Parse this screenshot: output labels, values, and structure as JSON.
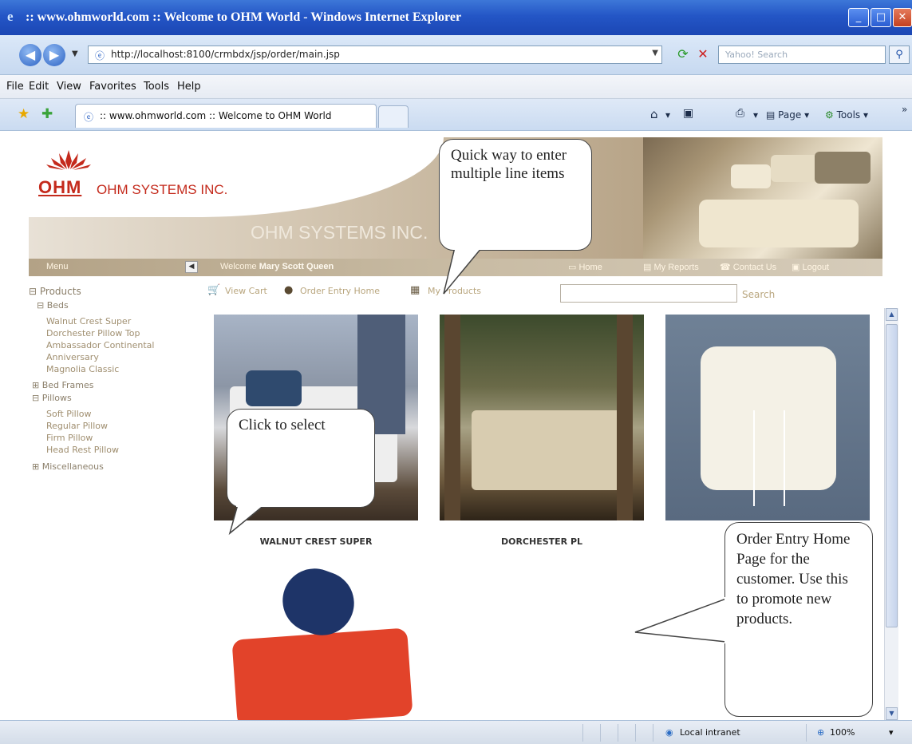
{
  "window": {
    "title": ":: www.ohmworld.com :: Welcome to OHM World - Windows Internet Explorer",
    "url": "http://localhost:8100/crmbdx/jsp/order/main.jsp",
    "search_placeholder": "Yahoo! Search"
  },
  "menubar": [
    "File",
    "Edit",
    "View",
    "Favorites",
    "Tools",
    "Help"
  ],
  "tab": {
    "label": ":: www.ohmworld.com :: Welcome to OHM World"
  },
  "toolbar": {
    "page_label": "Page",
    "tools_label": "Tools"
  },
  "banner": {
    "logo_text": "OHM",
    "company": "OHM SYSTEMS INC.",
    "watermark": "OHM SYSTEMS INC."
  },
  "nav": {
    "menu_label": "Menu",
    "welcome_prefix": "Welcome",
    "user_name": "Mary Scott Queen",
    "home": "Home",
    "my_reports": "My Reports",
    "contact_us": "Contact Us",
    "logout": "Logout"
  },
  "actions": {
    "view_cart": "View Cart",
    "order_entry_home": "Order Entry Home",
    "my_products": "My Products",
    "search": "Search"
  },
  "tree": {
    "products": "Products",
    "beds": "Beds",
    "bed_items": [
      "Walnut Crest Super",
      "Dorchester Pillow Top",
      "Ambassador Continental",
      "Anniversary",
      "Magnolia Classic"
    ],
    "bed_frames": "Bed Frames",
    "pillows": "Pillows",
    "pillow_items": [
      "Soft Pillow",
      "Regular Pillow",
      "Firm Pillow",
      "Head Rest Pillow"
    ],
    "miscellaneous": "Miscellaneous"
  },
  "products": [
    {
      "caption": "WALNUT CREST SUPER"
    },
    {
      "caption": "DORCHESTER PL"
    },
    {
      "caption": ""
    },
    {
      "caption": ""
    }
  ],
  "callouts": {
    "quick": "Quick way to enter multiple line items",
    "click": "Click to select",
    "order": "Order Entry Home Page for the customer. Use this to promote new products."
  },
  "status": {
    "zone": "Local intranet",
    "zoom": "100%"
  }
}
